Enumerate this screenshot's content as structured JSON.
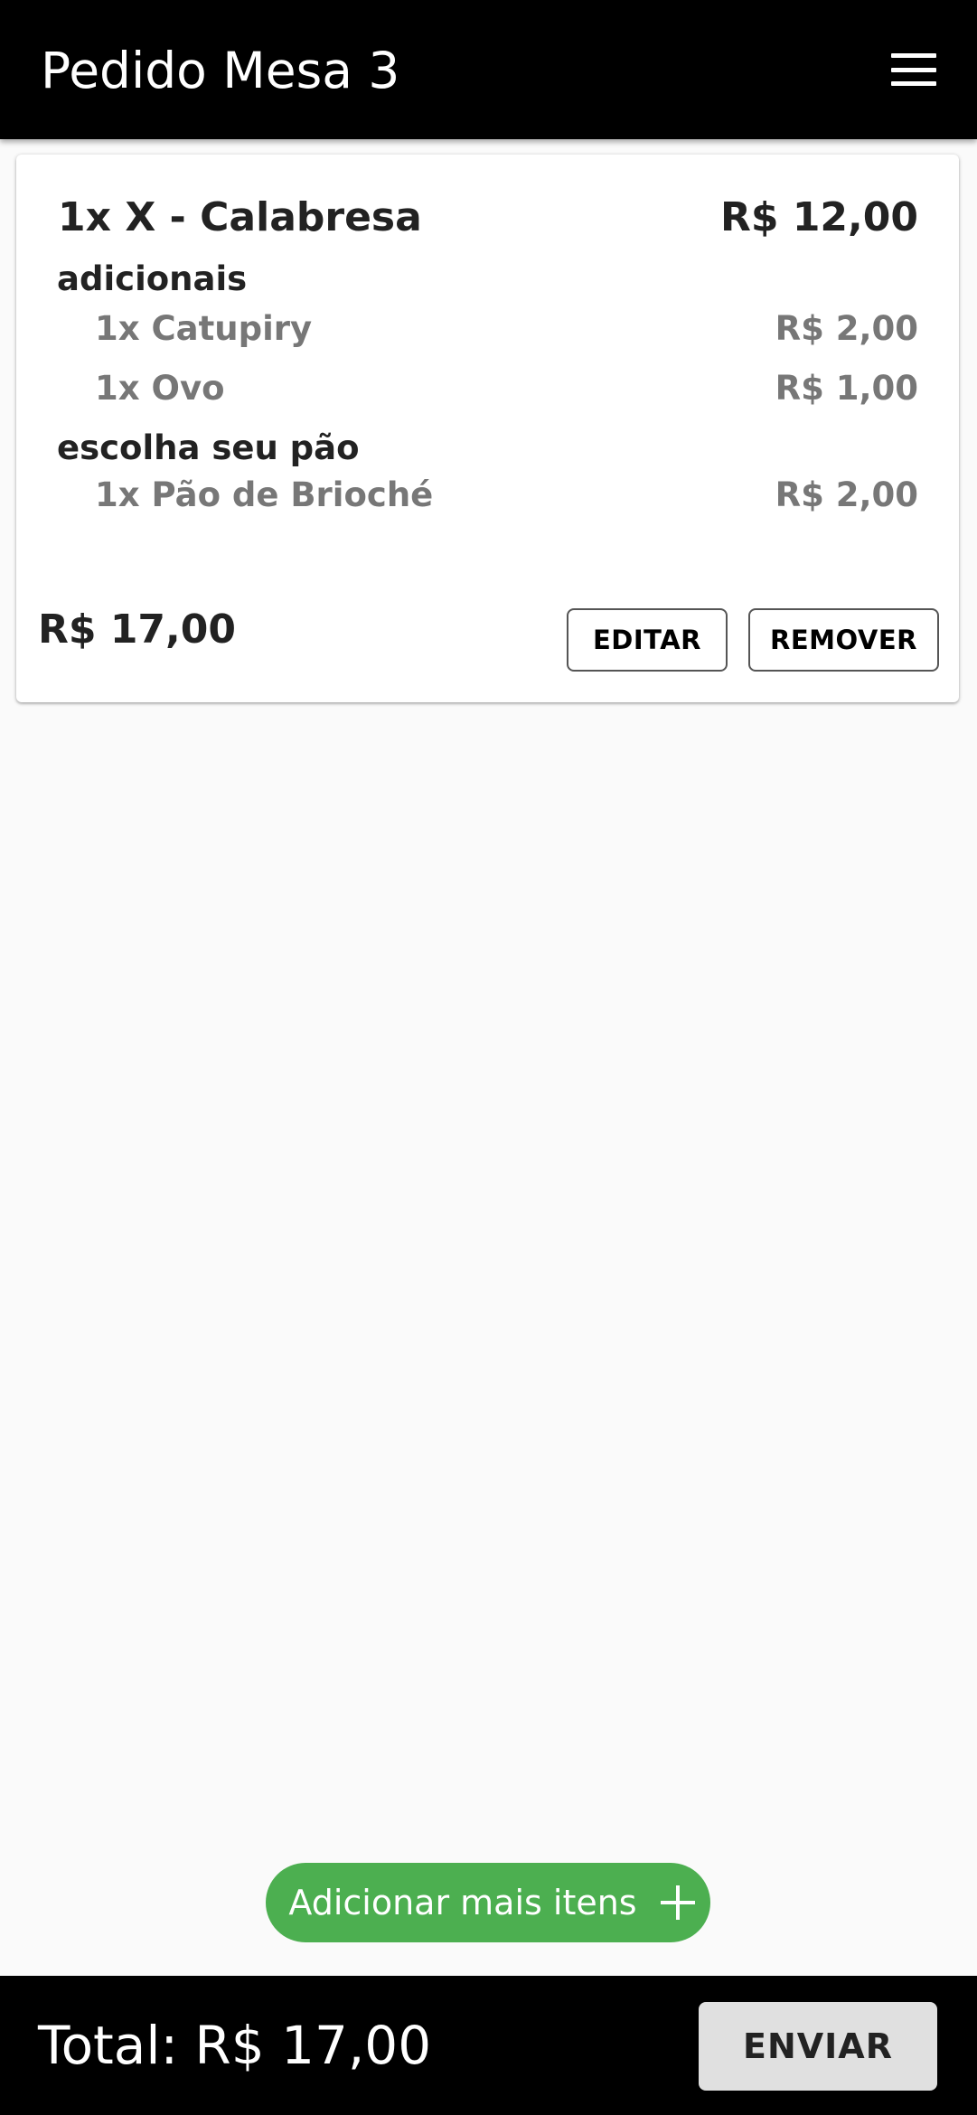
{
  "header": {
    "title": "Pedido Mesa 3",
    "menu_icon": "hamburger-menu-icon"
  },
  "order": {
    "item": {
      "name": "1x X - Calabresa",
      "price": "R$ 12,00"
    },
    "groups": [
      {
        "title": "adicionais",
        "options": [
          {
            "name": "1x Catupiry",
            "price": "R$ 2,00"
          },
          {
            "name": "1x Ovo",
            "price": "R$ 1,00"
          }
        ]
      },
      {
        "title": "escolha seu pão",
        "options": [
          {
            "name": "1x Pão de Brioché",
            "price": "R$ 2,00"
          }
        ]
      }
    ],
    "subtotal": "R$ 17,00",
    "edit_label": "EDITAR",
    "remove_label": "REMOVER"
  },
  "add_items": {
    "label": "Adicionar mais itens",
    "icon": "plus-icon"
  },
  "footer": {
    "total": "Total: R$ 17,00",
    "send_label": "ENVIAR"
  },
  "colors": {
    "app_bar": "#000000",
    "background": "#fafafa",
    "accent_green": "#4caf50",
    "send_button": "#e0e0e0",
    "secondary_text": "#777777"
  }
}
